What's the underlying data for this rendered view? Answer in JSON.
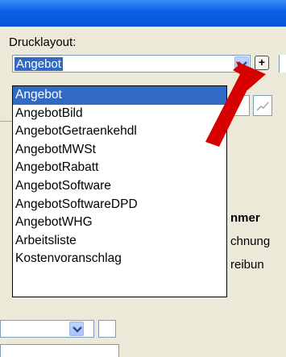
{
  "layout_label": "Drucklayout:",
  "combo": {
    "value": "Angebot"
  },
  "dropdown": {
    "items": [
      {
        "label": "Angebot",
        "selected": true
      },
      {
        "label": "AngebotBild"
      },
      {
        "label": "AngebotGetraenkehdl"
      },
      {
        "label": "AngebotMWSt"
      },
      {
        "label": "AngebotRabatt"
      },
      {
        "label": "AngebotSoftware"
      },
      {
        "label": "AngebotSoftwareDPD"
      },
      {
        "label": "AngebotWHG"
      },
      {
        "label": "Arbeitsliste"
      },
      {
        "label": "Kostenvoranschlag"
      }
    ]
  },
  "plus_label": "+",
  "background_text": {
    "line1": "nmer",
    "line2": "chnung",
    "line3": "reibun"
  },
  "colors": {
    "titlebar": "#0a5fe6",
    "selection": "#316ac5",
    "arrow": "#d60000"
  },
  "icons": [
    "chevron-down-icon",
    "plus-icon",
    "pen-icon",
    "red-arrow-annotation"
  ]
}
